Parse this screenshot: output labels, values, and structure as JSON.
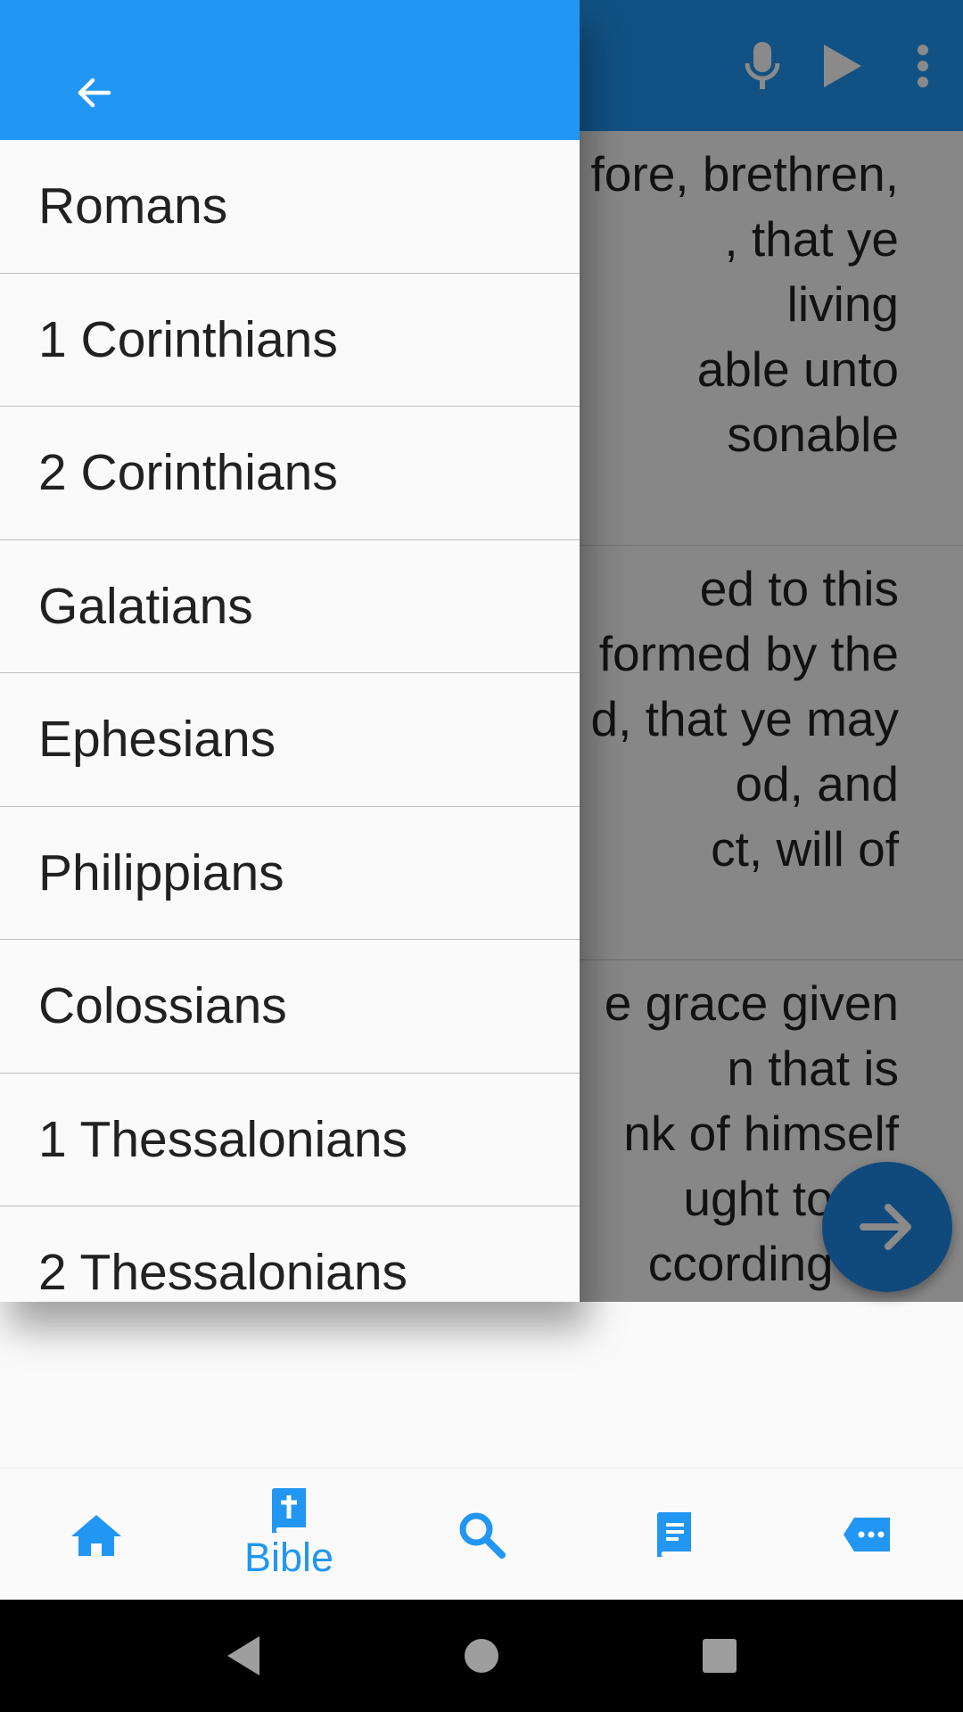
{
  "reader": {
    "verses": [
      [
        "fore, brethren,",
        ", that ye",
        "living",
        "able unto",
        "sonable"
      ],
      [
        "ed to this",
        "formed by the",
        "d, that ye may",
        "od, and",
        "ct, will of"
      ],
      [
        "e grace given",
        "n that is",
        "nk of himself",
        "ught to thi",
        "ccording as"
      ]
    ]
  },
  "app_bar": {
    "icons": [
      "mic-icon",
      "play-icon",
      "more-vert-icon"
    ]
  },
  "drawer": {
    "back_icon": "arrow-back-icon",
    "books": [
      "Romans",
      "1 Corinthians",
      "2 Corinthians",
      "Galatians",
      "Ephesians",
      "Philippians",
      "Colossians",
      "1 Thessalonians",
      "2 Thessalonians"
    ]
  },
  "fab": {
    "icon": "arrow-forward-icon"
  },
  "bottom_nav": {
    "items": [
      {
        "icon": "home-icon",
        "label": ""
      },
      {
        "icon": "bible-icon",
        "label": "Bible"
      },
      {
        "icon": "search-icon",
        "label": ""
      },
      {
        "icon": "book-icon",
        "label": ""
      },
      {
        "icon": "chat-icon",
        "label": ""
      }
    ],
    "active": "Bible"
  },
  "system_nav": {
    "icons": [
      "back-triangle-icon",
      "home-circle-icon",
      "recents-square-icon"
    ]
  },
  "colors": {
    "primary": "#2196f3",
    "text": "#212121",
    "scrim": "rgba(0,0,0,0.46)"
  }
}
